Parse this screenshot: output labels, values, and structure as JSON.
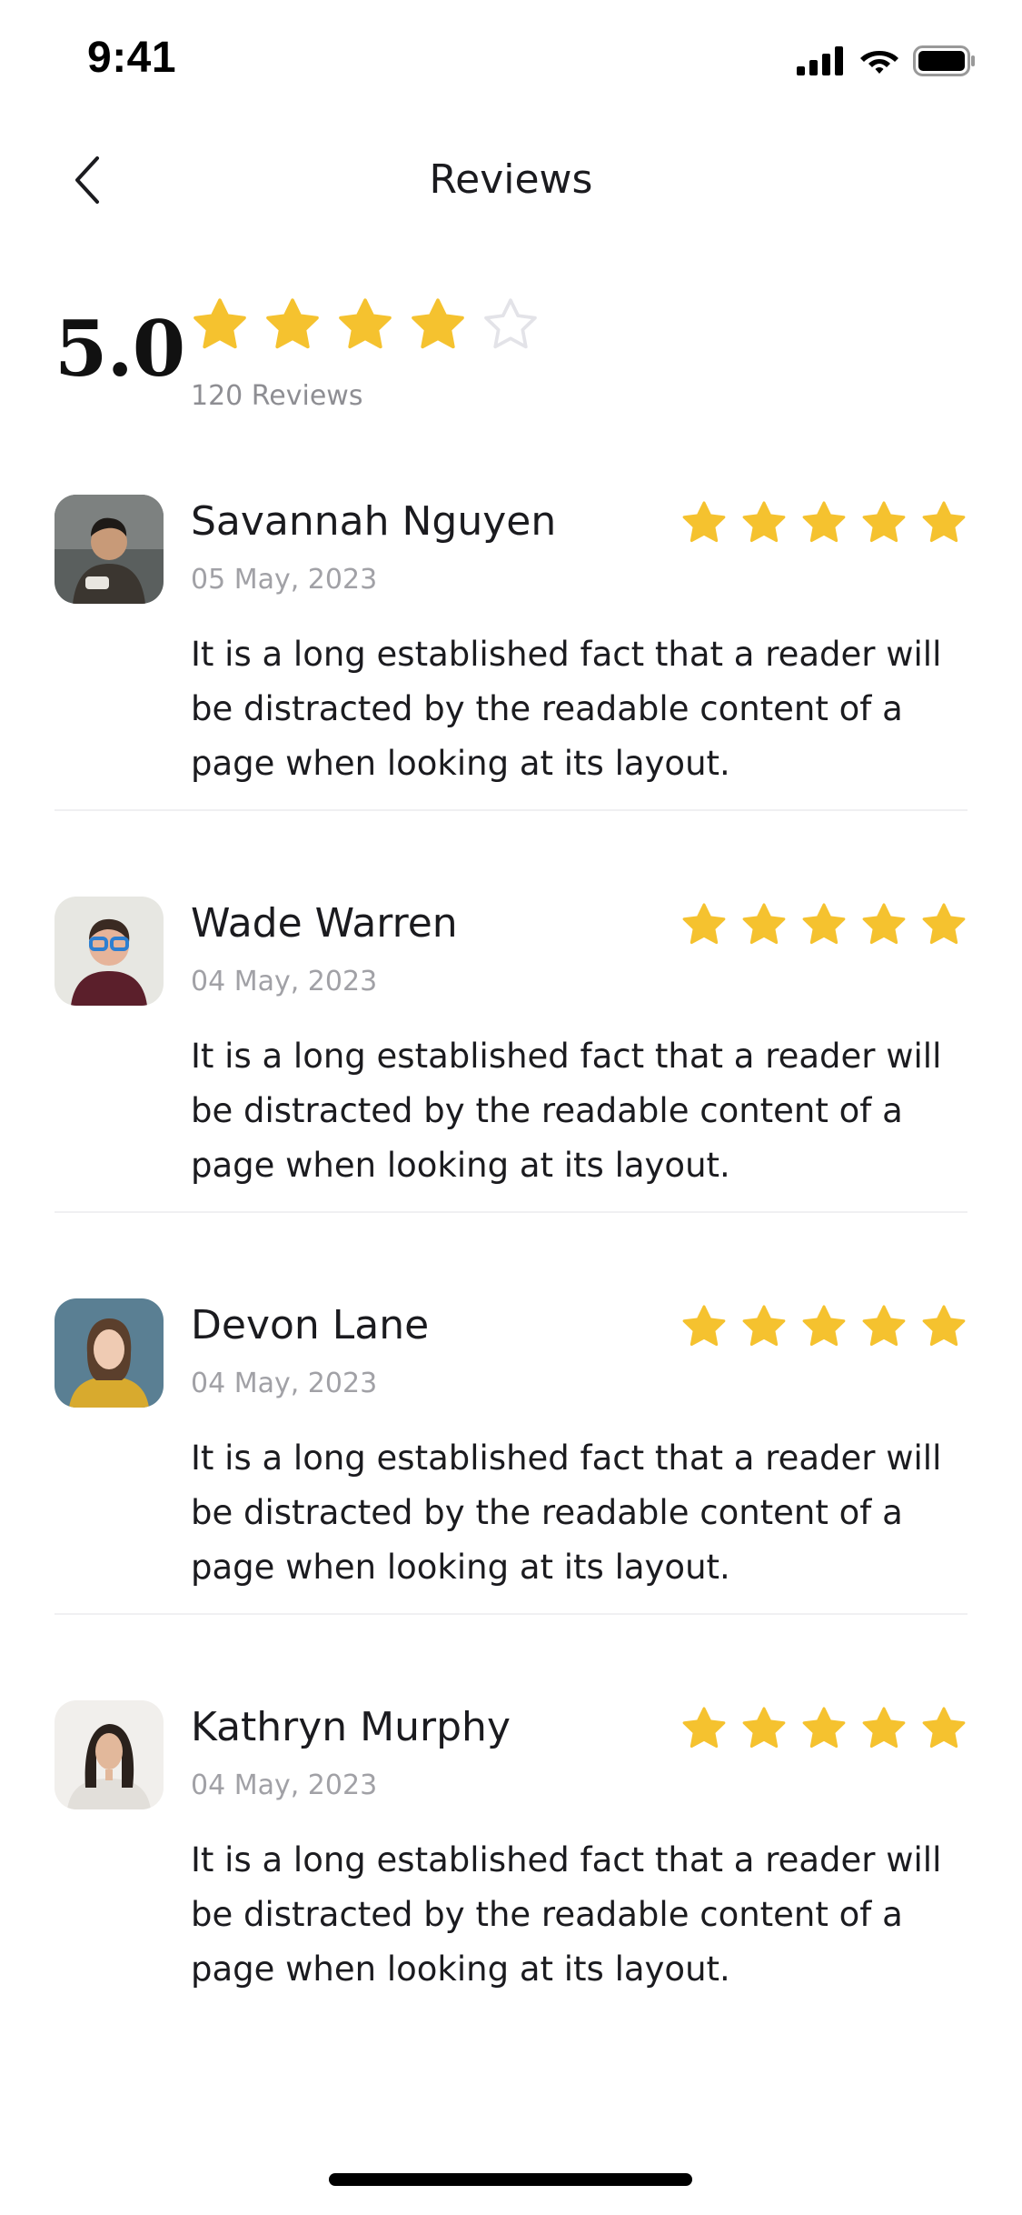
{
  "status_bar": {
    "time": "9:41",
    "icons": [
      "cellular-signal-icon",
      "wifi-icon",
      "battery-icon"
    ]
  },
  "header": {
    "back_icon": "chevron-left-icon",
    "title": "Reviews"
  },
  "summary": {
    "score": "5.0",
    "rating": 4,
    "max_rating": 5,
    "count_label": "120 Reviews"
  },
  "colors": {
    "star_filled": "#F5C22F",
    "star_empty_stroke": "#E3E3E8",
    "divider": "#F0F0F2"
  },
  "reviews": [
    {
      "name": "Savannah Nguyen",
      "date": "05 May, 2023",
      "rating": 5,
      "text": "It is a long established fact that a reader will be distracted by the readable content of a page when looking at its layout."
    },
    {
      "name": "Wade Warren",
      "date": "04 May, 2023",
      "rating": 5,
      "text": "It is a long established fact that a reader will be distracted by the readable content of a page when looking at its layout."
    },
    {
      "name": "Devon Lane",
      "date": "04 May, 2023",
      "rating": 5,
      "text": "It is a long established fact that a reader will be distracted by the readable content of a page when looking at its layout."
    },
    {
      "name": "Kathryn Murphy",
      "date": "04 May, 2023",
      "rating": 5,
      "text": "It is a long established fact that a reader will be distracted by the readable content of a page when looking at its layout."
    }
  ]
}
